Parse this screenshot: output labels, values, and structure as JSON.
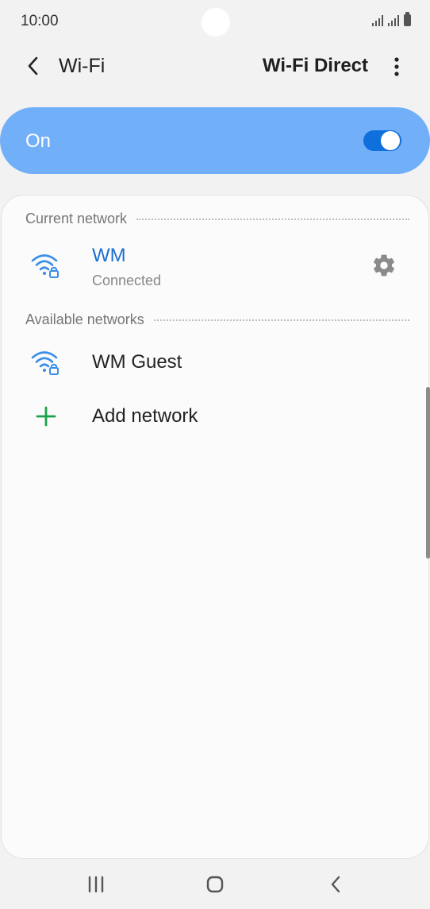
{
  "status_bar": {
    "time": "10:00"
  },
  "app_bar": {
    "title": "Wi-Fi",
    "action": "Wi-Fi Direct"
  },
  "wifi_toggle": {
    "label": "On",
    "state": true,
    "accent": "#0f6fdc",
    "banner_color": "#72aff9"
  },
  "current_network": {
    "header": "Current network",
    "network": {
      "name": "WM",
      "status": "Connected",
      "secured": true,
      "name_color": "#1a6fcf",
      "icon": "wifi-lock-icon"
    }
  },
  "available_networks": {
    "header": "Available networks",
    "networks": [
      {
        "name": "WM Guest",
        "secured": true,
        "icon": "wifi-lock-icon"
      }
    ]
  },
  "add_network": {
    "label": "Add network",
    "icon": "plus-icon",
    "icon_color": "#1aa24a"
  },
  "nav_bar": {
    "icons": [
      "recents-icon",
      "home-icon",
      "back-icon"
    ]
  }
}
